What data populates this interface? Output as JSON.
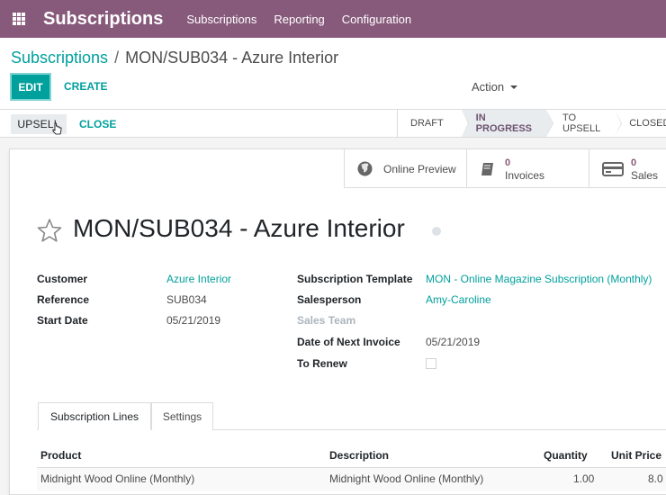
{
  "topbar": {
    "app_title": "Subscriptions",
    "menu": [
      "Subscriptions",
      "Reporting",
      "Configuration"
    ],
    "color": "#875a7b"
  },
  "control": {
    "breadcrumb_root": "Subscriptions",
    "breadcrumb_sep": "/",
    "breadcrumb_current": "MON/SUB034 - Azure Interior",
    "edit_label": "EDIT",
    "create_label": "CREATE",
    "action_label": "Action"
  },
  "statusbar": {
    "upsell_label": "UPSELL",
    "close_label": "CLOSE",
    "stages": [
      "DRAFT",
      "IN PROGRESS",
      "TO UPSELL",
      "CLOSED"
    ],
    "active_stage": "IN PROGRESS"
  },
  "buttonbox": {
    "online_preview": "Online Preview",
    "invoices_count": "0",
    "invoices_label": "Invoices",
    "sales_count": "0",
    "sales_label": "Sales"
  },
  "record": {
    "title": "MON/SUB034 - Azure Interior",
    "left_fields": [
      {
        "label": "Customer",
        "value": "Azure Interior"
      },
      {
        "label": "Reference",
        "value": "SUB034"
      },
      {
        "label": "Start Date",
        "value": "05/21/2019"
      }
    ],
    "right_fields": [
      {
        "label": "Subscription Template",
        "value": "MON - Online Magazine Subscription (Monthly)"
      },
      {
        "label": "Salesperson",
        "value": "Amy-Caroline"
      },
      {
        "label": "Sales Team",
        "value": ""
      },
      {
        "label": "Date of Next Invoice",
        "value": "05/21/2019"
      },
      {
        "label": "To Renew",
        "value": ""
      }
    ]
  },
  "notebook": {
    "tabs": [
      "Subscription Lines",
      "Settings"
    ]
  },
  "lines": {
    "headers": [
      "Product",
      "Description",
      "Quantity",
      "Unit Price"
    ],
    "rows": [
      [
        "Midnight Wood Online (Monthly)",
        "Midnight Wood Online (Monthly)",
        "1.00",
        "8.0"
      ]
    ]
  },
  "accent": "#00a09d"
}
